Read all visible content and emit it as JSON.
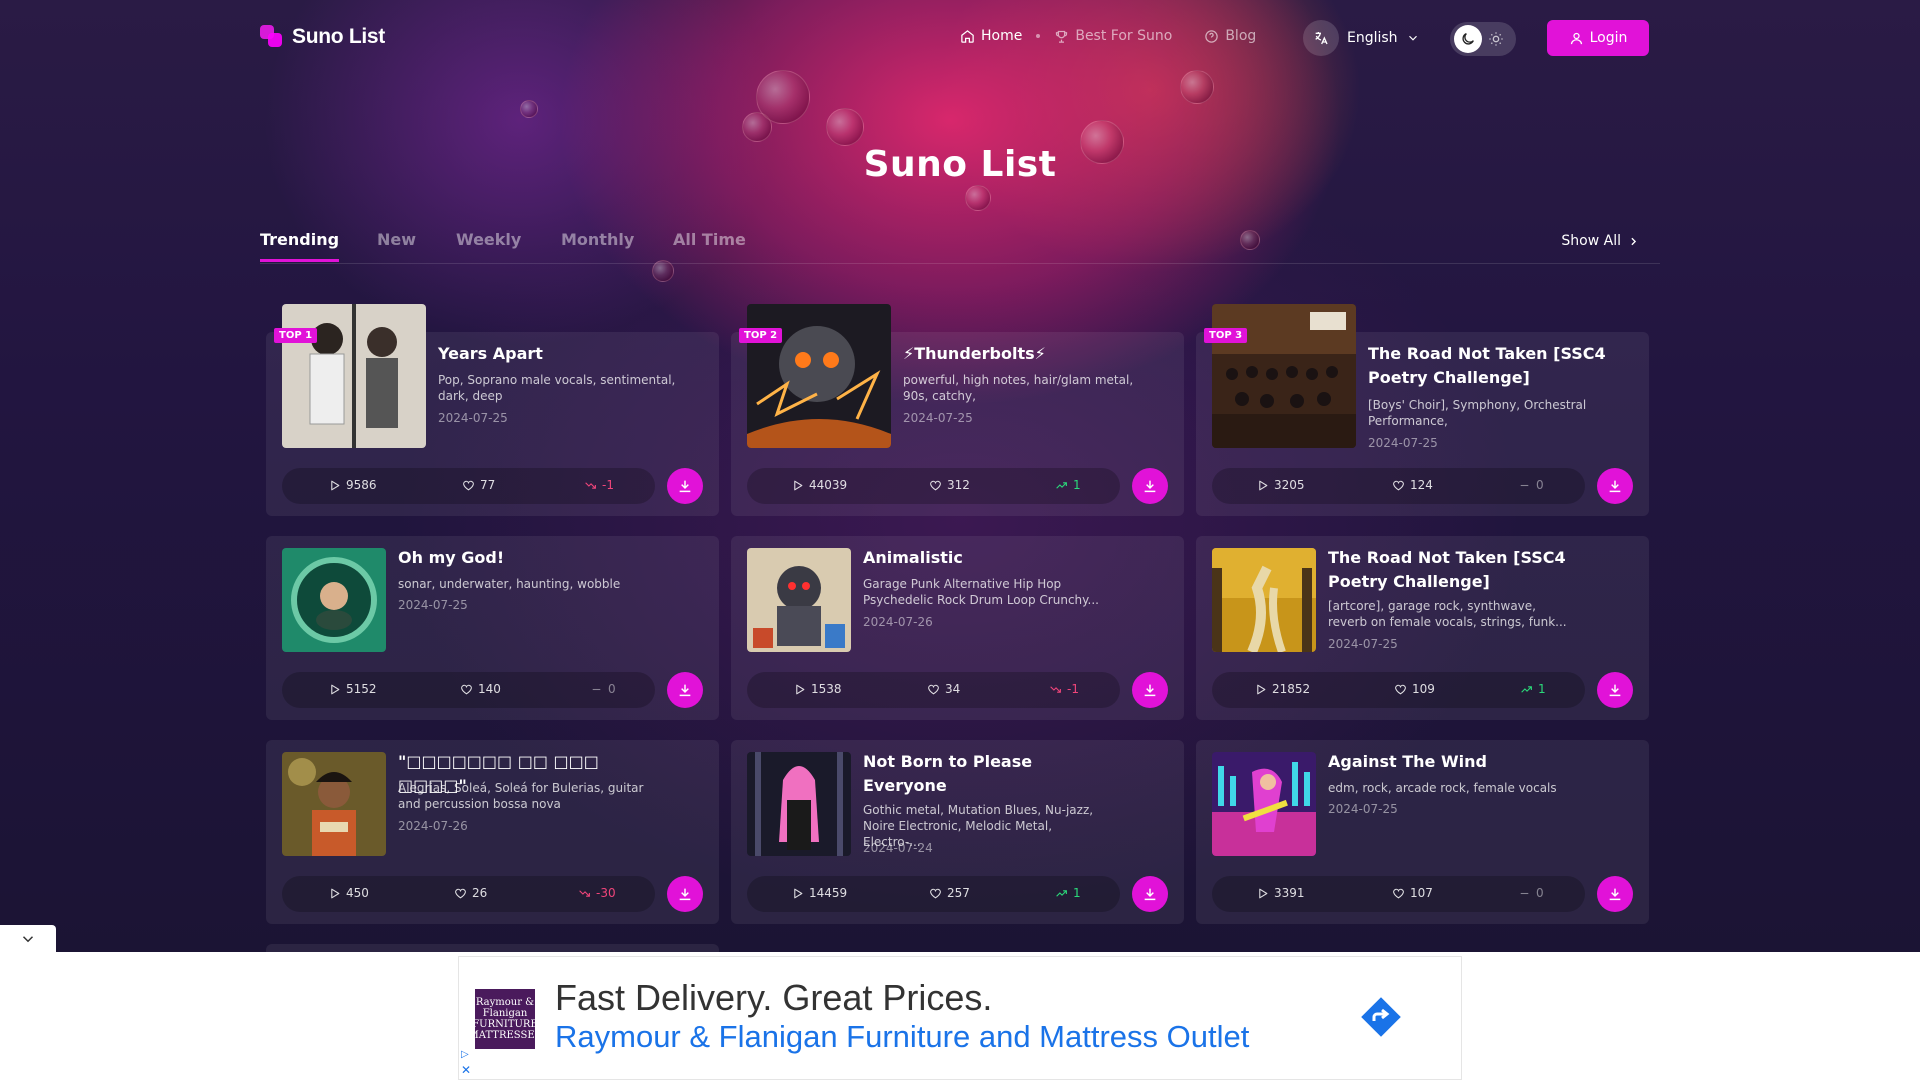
{
  "header": {
    "logo_text": "Suno List",
    "nav": [
      {
        "label": "Home",
        "icon": "home-icon",
        "active": true
      },
      {
        "label": "Best For Suno",
        "icon": "trophy-icon",
        "active": false
      },
      {
        "label": "Blog",
        "icon": "help-circle-icon",
        "active": false
      }
    ],
    "language": "English",
    "login_label": "Login"
  },
  "page_title": "Suno List",
  "tabs": [
    "Trending",
    "New",
    "Weekly",
    "Monthly",
    "All Time"
  ],
  "show_all": "Show All",
  "songs": [
    {
      "rank": "TOP 1",
      "title": "Years Apart",
      "tags": "Pop, Soprano male vocals, sentimental, dark, deep",
      "date": "2024-07-25",
      "plays": "9586",
      "likes": "77",
      "trend": "-1",
      "trend_dir": "down"
    },
    {
      "rank": "TOP 2",
      "title": "⚡Thunderbolts⚡",
      "tags": "powerful, high notes, hair/glam metal, 90s, catchy,",
      "date": "2024-07-25",
      "plays": "44039",
      "likes": "312",
      "trend": "1",
      "trend_dir": "up"
    },
    {
      "rank": "TOP 3",
      "title": "The Road Not Taken [SSC4 Poetry Challenge]",
      "tags": "[Boys' Choir], Symphony, Orchestral Performance,",
      "date": "2024-07-25",
      "plays": "3205",
      "likes": "124",
      "trend": "0",
      "trend_dir": "flat"
    },
    {
      "title": "Oh my God!",
      "tags": "sonar, underwater, haunting, wobble",
      "date": "2024-07-25",
      "plays": "5152",
      "likes": "140",
      "trend": "0",
      "trend_dir": "flat"
    },
    {
      "title": "Animalistic",
      "tags": "Garage Punk Alternative Hip Hop Psychedelic Rock Drum Loop Crunchy...",
      "date": "2024-07-26",
      "plays": "1538",
      "likes": "34",
      "trend": "-1",
      "trend_dir": "down"
    },
    {
      "title": "The Road Not Taken [SSC4 Poetry Challenge]",
      "tags": "[artcore], garage rock, synthwave, reverb on female vocals, strings, funk...",
      "date": "2024-07-25",
      "plays": "21852",
      "likes": "109",
      "trend": "1",
      "trend_dir": "up"
    },
    {
      "title": "\"□□□□□□□ □□ □□□ □□□□\"",
      "tags": "Alegrias, Soleá, Soleá for Bulerias, guitar and percussion bossa nova",
      "date": "2024-07-26",
      "plays": "450",
      "likes": "26",
      "trend": "-30",
      "trend_dir": "down"
    },
    {
      "title": "Not Born to Please Everyone",
      "tags": "Gothic metal, Mutation Blues, Nu-jazz, Noire Electronic, Melodic Metal, Electro-...",
      "date": "2024-07-24",
      "plays": "14459",
      "likes": "257",
      "trend": "1",
      "trend_dir": "up"
    },
    {
      "title": "Against The Wind",
      "tags": "edm, rock, arcade rock, female vocals",
      "date": "2024-07-25",
      "plays": "3391",
      "likes": "107",
      "trend": "0",
      "trend_dir": "flat"
    }
  ],
  "ad": {
    "logo_text": "Raymour & Flanigan FURNITURE MATTRESSES",
    "headline": "Fast Delivery. Great Prices.",
    "subline": "Raymour & Flanigan Furniture and Mattress Outlet"
  },
  "colors": {
    "accent": "#e112d8",
    "up": "#2bd97a",
    "down": "#f0457a"
  }
}
